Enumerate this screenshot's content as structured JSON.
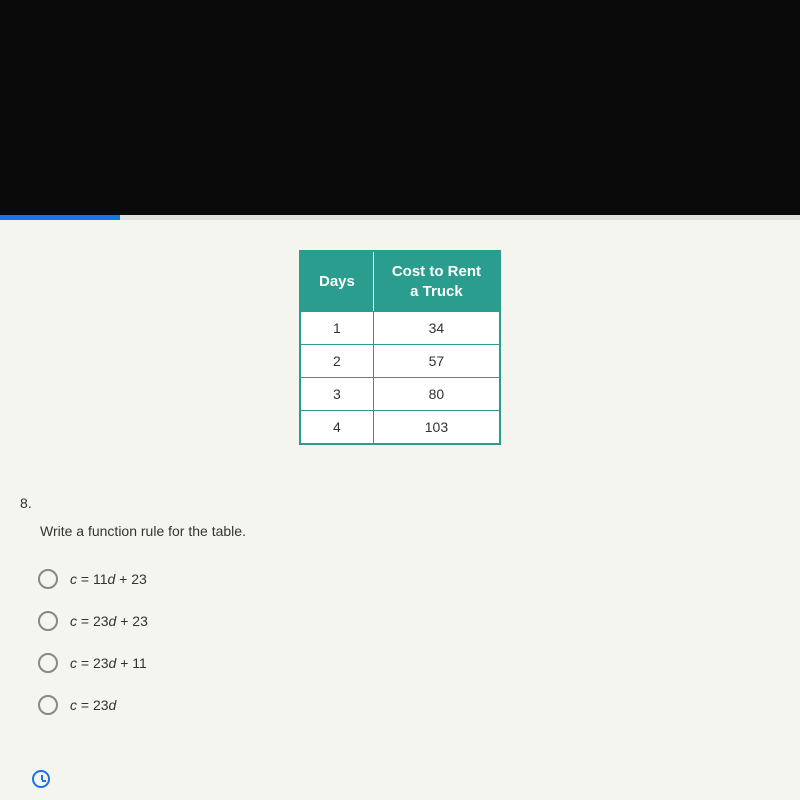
{
  "table": {
    "headers": {
      "col1": "Days",
      "col2_line1": "Cost to Rent",
      "col2_line2": "a Truck"
    },
    "rows": [
      {
        "days": "1",
        "cost": "34"
      },
      {
        "days": "2",
        "cost": "57"
      },
      {
        "days": "3",
        "cost": "80"
      },
      {
        "days": "4",
        "cost": "103"
      }
    ]
  },
  "question": {
    "number": "8.",
    "text": "Write a function rule for the table."
  },
  "options": {
    "a": {
      "var_c": "c",
      "eq": " = 11",
      "var_d": "d",
      "rest": " + 23"
    },
    "b": {
      "var_c": "c",
      "eq": " = 23",
      "var_d": "d",
      "rest": " + 23"
    },
    "c": {
      "var_c": "c",
      "eq": " = 23",
      "var_d": "d",
      "rest": " + 11"
    },
    "d": {
      "var_c": "c",
      "eq": " = 23",
      "var_d": "d",
      "rest": ""
    }
  },
  "chart_data": {
    "type": "table",
    "headers": [
      "Days",
      "Cost to Rent a Truck"
    ],
    "rows": [
      [
        1,
        34
      ],
      [
        2,
        57
      ],
      [
        3,
        80
      ],
      [
        4,
        103
      ]
    ]
  }
}
